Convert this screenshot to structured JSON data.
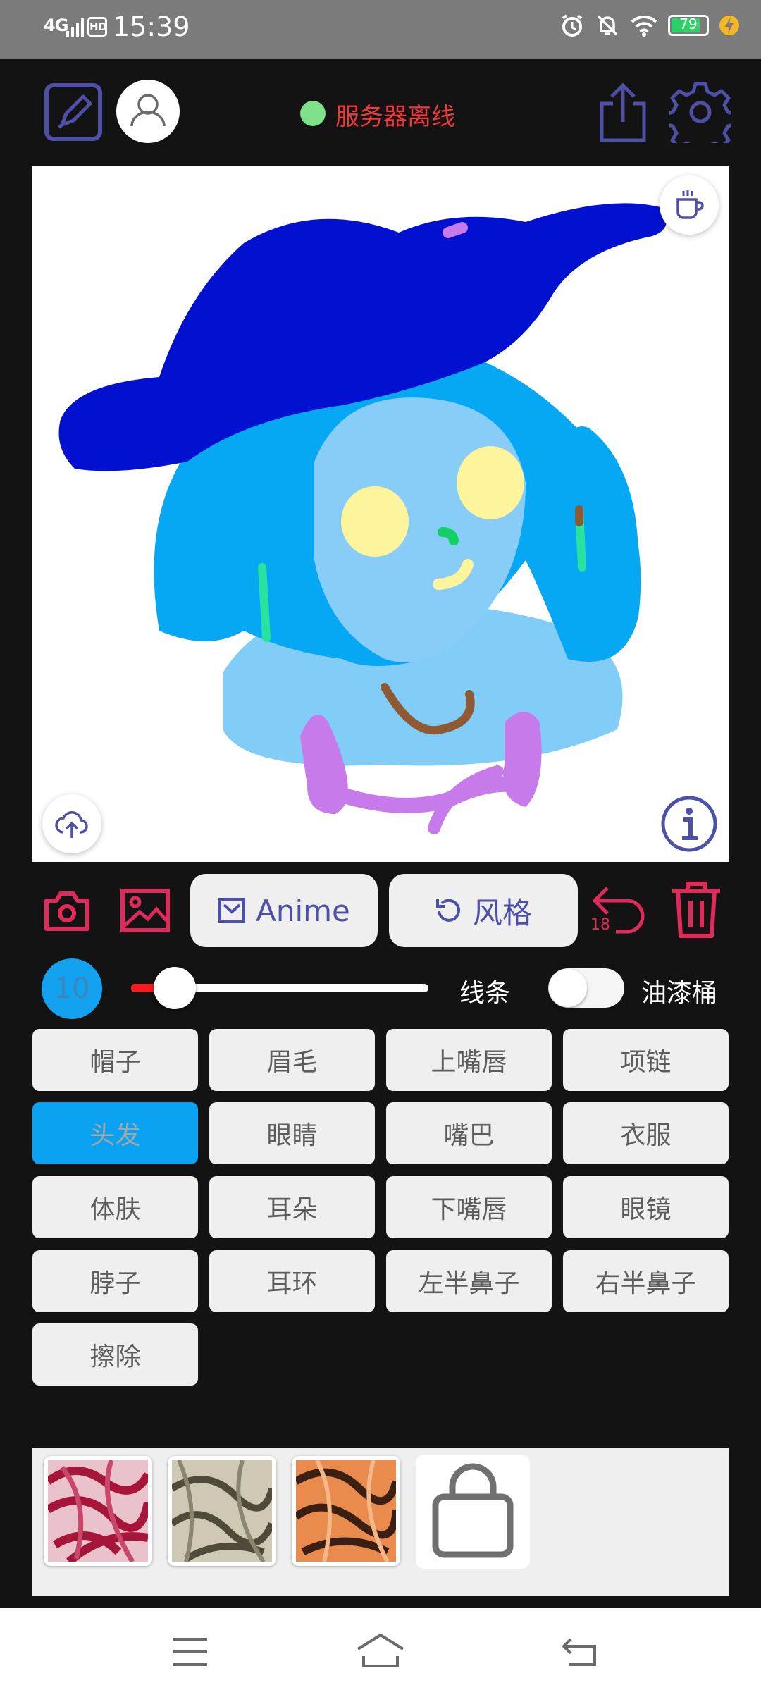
{
  "status_bar": {
    "network": "4G",
    "hd": "HD",
    "time": "15:39",
    "battery": "79"
  },
  "toolbar": {
    "server_status": "服务器离线",
    "server_dot_color": "#7ee089",
    "server_text_color": "#f03a3a"
  },
  "canvas_buttons": {
    "coffee": "coffee-cup-icon",
    "upload": "cloud-upload-icon",
    "info": "info-icon"
  },
  "tools": {
    "anime_label": "Anime",
    "style_label": "风格",
    "undo_count": "18"
  },
  "brush": {
    "size": "10",
    "size_fraction": 0.1,
    "lines_label": "线条",
    "bucket_label": "油漆桶",
    "bucket_on": false
  },
  "parts": [
    {
      "label": "帽子"
    },
    {
      "label": "眉毛"
    },
    {
      "label": "上嘴唇"
    },
    {
      "label": "项链"
    },
    {
      "label": "头发",
      "active": true
    },
    {
      "label": "眼睛"
    },
    {
      "label": "嘴巴"
    },
    {
      "label": "衣服"
    },
    {
      "label": "体肤"
    },
    {
      "label": "耳朵"
    },
    {
      "label": "下嘴唇"
    },
    {
      "label": "眼镜"
    },
    {
      "label": "脖子"
    },
    {
      "label": "耳环"
    },
    {
      "label": "左半鼻子"
    },
    {
      "label": "右半鼻子"
    },
    {
      "label": "擦除"
    }
  ],
  "colors": {
    "accent": "#4e4fa6",
    "red": "#e12a5c",
    "active_part": "#0aa2f0"
  }
}
